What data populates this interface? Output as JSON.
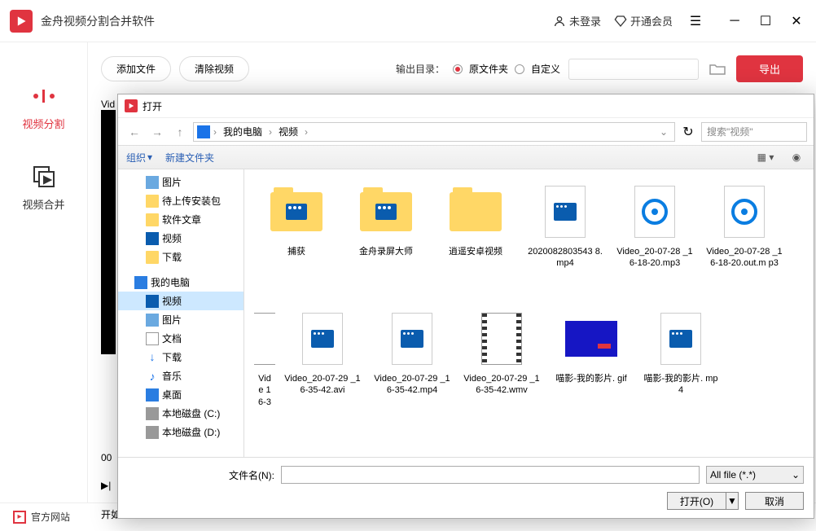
{
  "app": {
    "title": "金舟视频分割合并软件",
    "login": "未登录",
    "vip": "开通会员"
  },
  "sidebar": {
    "items": [
      {
        "label": "视频分割"
      },
      {
        "label": "视频合并"
      }
    ]
  },
  "toolbar": {
    "add": "添加文件",
    "clear": "清除视频",
    "output_label": "输出目录：",
    "radio_original": "原文件夹",
    "radio_custom": "自定义",
    "export": "导出"
  },
  "preview": {
    "tab": "Vid",
    "time": "00",
    "start_label": "开如"
  },
  "footer": {
    "website": "官方网站"
  },
  "dialog": {
    "title": "打开",
    "breadcrumb": [
      "我的电脑",
      "视频"
    ],
    "search_placeholder": "搜索\"视频\"",
    "org": "组织",
    "newfolder": "新建文件夹",
    "tree_quick": [
      {
        "label": "图片",
        "cls": "tree-pic"
      },
      {
        "label": "待上传安装包",
        "cls": "tree-folder"
      },
      {
        "label": "软件文章",
        "cls": "tree-folder"
      },
      {
        "label": "视频",
        "cls": "tree-vid"
      },
      {
        "label": "下载",
        "cls": "tree-folder"
      }
    ],
    "tree_pc_label": "我的电脑",
    "tree_pc": [
      {
        "label": "视频",
        "cls": "tree-vid"
      },
      {
        "label": "图片",
        "cls": "tree-pic"
      },
      {
        "label": "文档",
        "cls": "tree-doc"
      },
      {
        "label": "下载",
        "cls": "tree-down"
      },
      {
        "label": "音乐",
        "cls": "tree-music"
      },
      {
        "label": "桌面",
        "cls": "tree-pc"
      },
      {
        "label": "本地磁盘 (C:)",
        "cls": "tree-disk"
      },
      {
        "label": "本地磁盘 (D:)",
        "cls": "tree-disk"
      }
    ],
    "files": [
      {
        "name": "捕获",
        "type": "folder-vid"
      },
      {
        "name": "金舟录屏大师",
        "type": "folder-vid"
      },
      {
        "name": "逍遥安卓视频",
        "type": "folder"
      },
      {
        "name": "2020082803543 8.mp4",
        "type": "video"
      },
      {
        "name": "Video_20-07-28 _16-18-20.mp3",
        "type": "audio"
      },
      {
        "name": "Video_20-07-28 _16-18-20.out.m p3",
        "type": "audio"
      },
      {
        "name": "Vide 16-3",
        "type": "partial"
      },
      {
        "name": "Video_20-07-29 _16-35-42.avi",
        "type": "video"
      },
      {
        "name": "Video_20-07-29 _16-35-42.mp4",
        "type": "video"
      },
      {
        "name": "Video_20-07-29 _16-35-42.wmv",
        "type": "film"
      },
      {
        "name": "喵影-我的影片. gif",
        "type": "gif"
      },
      {
        "name": "喵影-我的影片. mp4",
        "type": "video"
      }
    ],
    "filename_label": "文件名(N):",
    "filter": "All file (*.*)",
    "open_btn": "打开(O)",
    "cancel_btn": "取消"
  }
}
